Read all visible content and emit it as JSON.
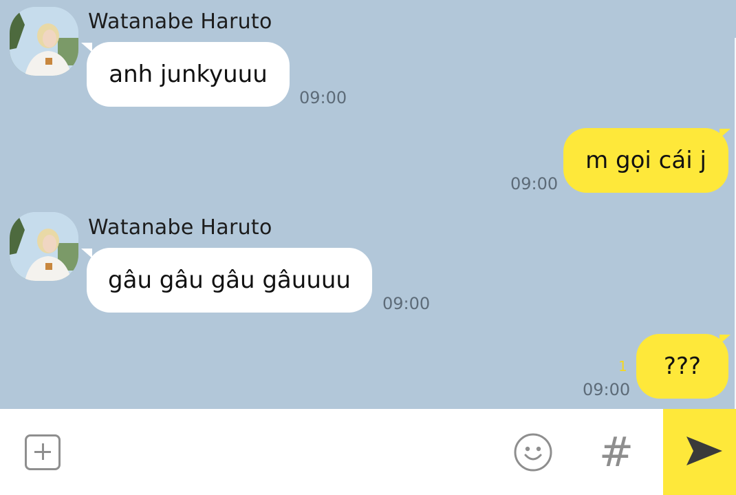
{
  "messages": [
    {
      "direction": "in",
      "sender": "Watanabe Haruto",
      "text": "anh junkyuuu",
      "time": "09:00"
    },
    {
      "direction": "out",
      "text": "m gọi cái j",
      "time": "09:00"
    },
    {
      "direction": "in",
      "sender": "Watanabe Haruto",
      "text": "gâu gâu gâu gâuuuu",
      "time": "09:00"
    },
    {
      "direction": "out",
      "text": "???",
      "time": "09:00",
      "unread": "1"
    }
  ],
  "input": {
    "attach_icon": "plus-square-icon",
    "emoji_icon": "smiley-icon",
    "hashtag_label": "#",
    "send_icon": "paper-plane-icon"
  },
  "colors": {
    "chat_background": "#b2c7d9",
    "incoming_bubble": "#ffffff",
    "outgoing_bubble": "#fee83a",
    "send_button": "#fee83a",
    "unread_count": "#f5d81e"
  }
}
